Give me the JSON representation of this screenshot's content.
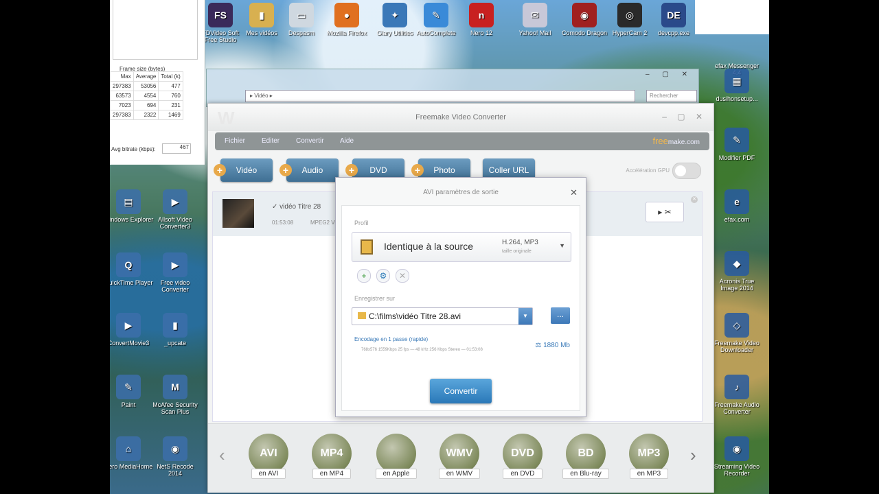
{
  "desktop_top_icons": [
    {
      "label": "FDVideo Soft Free Studio",
      "glyph": "FS",
      "color": "#3a2a5a"
    },
    {
      "label": "Mes vidéos",
      "glyph": "▮",
      "color": "#d8b050"
    },
    {
      "label": "Despasm",
      "glyph": "▭",
      "color": "#cfd8e0"
    },
    {
      "label": "Mozilla Firefox",
      "glyph": "●",
      "color": "#e07020"
    },
    {
      "label": "Glary Utilities",
      "glyph": "✦",
      "color": "#3a78b8"
    },
    {
      "label": "AutoComplete",
      "glyph": "✎",
      "color": "#3a8ad8"
    },
    {
      "label": "Nero 12",
      "glyph": "n",
      "color": "#c82020"
    },
    {
      "label": "Yahoo! Mail",
      "glyph": "✉",
      "color": "#c8c8d8"
    },
    {
      "label": "Comodo Dragon",
      "glyph": "◉",
      "color": "#a02020"
    },
    {
      "label": "HyperCam 2",
      "glyph": "◎",
      "color": "#2a2a2a"
    },
    {
      "label": "devcpp.exe",
      "glyph": "DE",
      "color": "#2a4a8a"
    }
  ],
  "desktop_left_icons": [
    {
      "label": "Windows Explorer",
      "glyph": "▤"
    },
    {
      "label": "Allsoft Video Converter3",
      "glyph": "▶"
    },
    {
      "label": "QuickTime Player",
      "glyph": "Q"
    },
    {
      "label": "Free video Converter",
      "glyph": "▶"
    },
    {
      "label": "ConvertMovie3",
      "glyph": "▶"
    },
    {
      "label": "_upcate",
      "glyph": "▮"
    },
    {
      "label": "Paint",
      "glyph": "✎"
    },
    {
      "label": "McAfee Security Scan Plus",
      "glyph": "M"
    },
    {
      "label": "Nero MediaHome",
      "glyph": "⌂"
    },
    {
      "label": "NetS Recode 2014",
      "glyph": "◉"
    }
  ],
  "desktop_right_icons": [
    {
      "label": "efax Messenger 4.4",
      "glyph": ""
    },
    {
      "label": "dusihonsetup...",
      "glyph": "▦"
    },
    {
      "label": "Modifier PDF",
      "glyph": "✎"
    },
    {
      "label": "efax.com",
      "glyph": "e"
    },
    {
      "label": "Acronis True Image 2014",
      "glyph": "◆"
    },
    {
      "label": "Freemake Video Downloader",
      "glyph": "◇"
    },
    {
      "label": "Freemake Audio Converter",
      "glyph": "♪"
    },
    {
      "label": "Streaming Video Recorder",
      "glyph": "◉"
    }
  ],
  "stats_panel": {
    "header": "Frame size (bytes)",
    "columns": [
      "Max",
      "Average",
      "Total (k)"
    ],
    "rows": [
      [
        "297383",
        "53056",
        "477"
      ],
      [
        "63573",
        "4554",
        "760"
      ],
      [
        "7023",
        "694",
        "231"
      ],
      [
        "297383",
        "2322",
        "1469"
      ]
    ],
    "avg_label": "Avg bitrate (kbps):",
    "avg_value": "467"
  },
  "explorer": {
    "address": "▸ Vidéo ▸",
    "search_placeholder": "Rechercher"
  },
  "freemake": {
    "title": "Freemake Video Converter",
    "menu": [
      "Fichier",
      "Editer",
      "Convertir",
      "Aide"
    ],
    "brand_a": "free",
    "brand_b": "make.com",
    "toolbar": [
      "Vidéo",
      "Audio",
      "DVD",
      "Photo",
      "Coller URL"
    ],
    "toggle_label": "Accélération GPU",
    "file": {
      "name": "vidéo Titre 28",
      "duration": "01:53:08",
      "codec": "MPEG2 Video"
    },
    "formats": [
      "en AVI",
      "en MP4",
      "en Apple",
      "en WMV",
      "en DVD",
      "en Blu-ray",
      "en MP3"
    ],
    "format_glyphs": [
      "AVI",
      "MP4",
      "",
      "WMV",
      "DVD",
      "BD",
      "MP3"
    ]
  },
  "dialog": {
    "title": "AVI paramètres de sortie",
    "profile_label": "Profil",
    "profile_name": "Identique à la source",
    "profile_codec": "H.264, MP3",
    "profile_sub": "taille originale",
    "save_label": "Enregistrer sur",
    "save_path": "C:\\films\\vidéo Titre 28.avi",
    "browse": "...",
    "encoding": "Encodage en 1 passe (rapide)",
    "encoding_details": "768x576  1559Kbps  25 fps  —  48 kHz  256 Kbps  Stereo  —  01:53:08",
    "size": "1880 Mb",
    "convert": "Convertir"
  }
}
